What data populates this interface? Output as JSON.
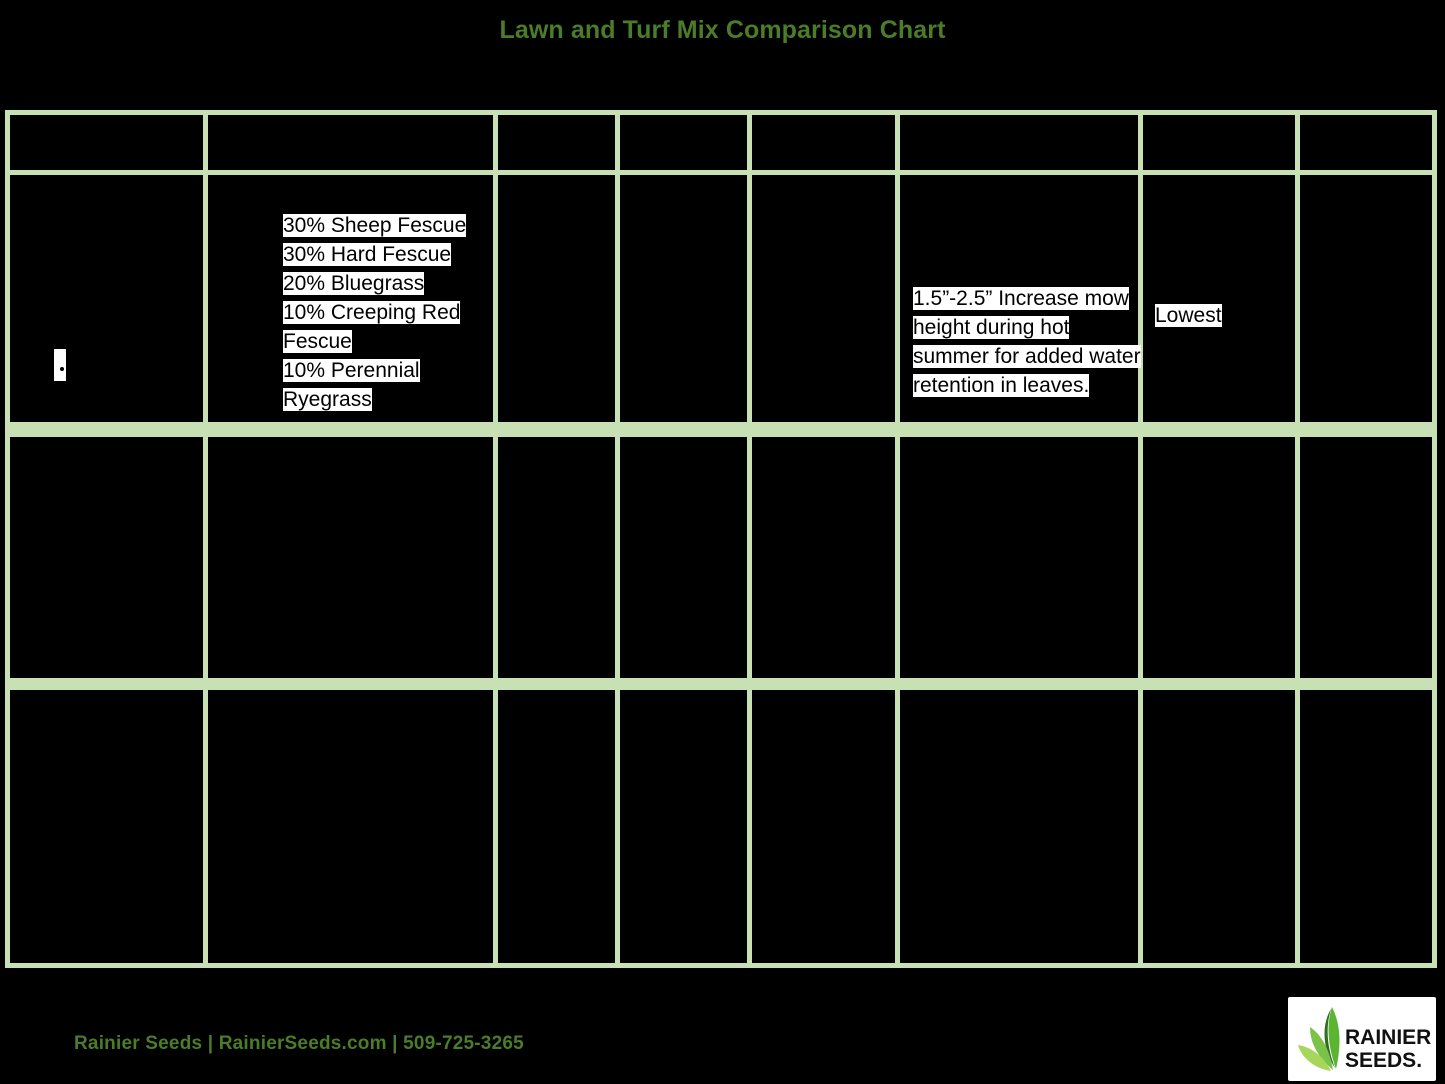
{
  "title": "Lawn and Turf Mix Comparison Chart",
  "table": {
    "columns": [
      {
        "key": "mix_name",
        "header": ""
      },
      {
        "key": "components",
        "header": ""
      },
      {
        "key": "col3",
        "header": ""
      },
      {
        "key": "col4",
        "header": ""
      },
      {
        "key": "col5",
        "header": ""
      },
      {
        "key": "mow_height",
        "header": ""
      },
      {
        "key": "col7",
        "header": ""
      },
      {
        "key": "col8",
        "header": ""
      }
    ],
    "rows": [
      {
        "mix_name": "",
        "components": "30% Sheep Fescue\n30% Hard Fescue\n20% Bluegrass\n10% Creeping Red Fescue\n10% Perennial Ryegrass",
        "col3": "",
        "col4": "",
        "col5": "",
        "mow_height": "1.5”-2.5” Increase mow height during hot summer for added water retention in leaves.",
        "col7": "Lowest",
        "col8": ""
      },
      {
        "mix_name": "",
        "components": "",
        "col3": "",
        "col4": "",
        "col5": "",
        "mow_height": "",
        "col7": "",
        "col8": ""
      },
      {
        "mix_name": "",
        "components": "",
        "col3": "",
        "col4": "",
        "col5": "",
        "mow_height": "",
        "col7": "",
        "col8": ""
      }
    ]
  },
  "footer": {
    "text": "Rainier Seeds | RainierSeeds.com | 509-725-3265",
    "logo_line1": "RAINIER",
    "logo_line2": "SEEDS."
  },
  "colors": {
    "grid": "#c7e0b4",
    "title_green": "#4a7c2a",
    "cell_bg": "#000000",
    "page_bg": "#000000",
    "highlight": "#ffffff"
  }
}
